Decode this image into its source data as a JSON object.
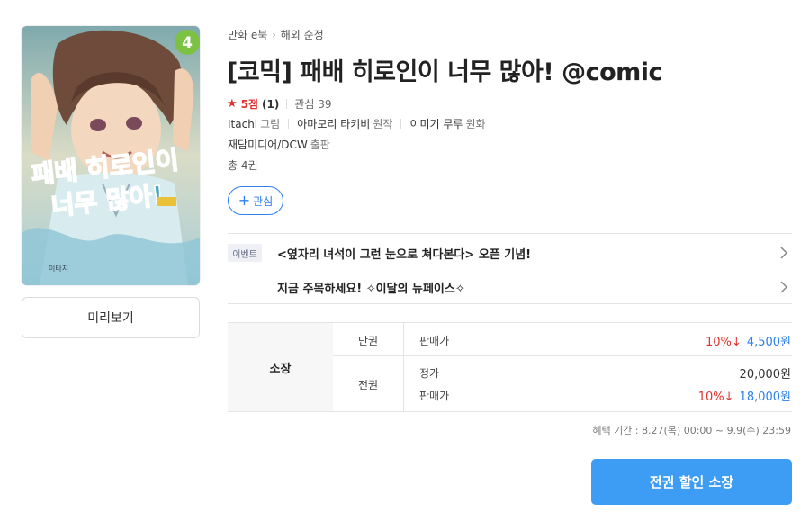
{
  "cover": {
    "volume_number": "4",
    "title_line1": "패배 히로인이",
    "title_line2": "너무 많아!",
    "author": "이타치"
  },
  "preview_label": "미리보기",
  "breadcrumb": [
    "만화 e북",
    "해외 순정"
  ],
  "title": "[코믹] 패배 히로인이 너무 많아! @comic",
  "rating": {
    "score": "5점",
    "count": "(1)",
    "wish": "관심 39"
  },
  "credits": [
    {
      "name": "Itachi",
      "role": "그림"
    },
    {
      "name": "아마모리 타키비",
      "role": "원작"
    },
    {
      "name": "이미기 무루",
      "role": "원화"
    }
  ],
  "publisher": {
    "name": "재담미디어/DCW",
    "role": "출판"
  },
  "volumes": "총 4권",
  "wish_button": "관심",
  "events": [
    {
      "badge": "이벤트",
      "text": "<옆자리 녀석이 그런 눈으로 쳐다본다> 오픈 기념!"
    },
    {
      "badge": "",
      "text": "지금 주목하세요! ✧이달의 뉴페이스✧"
    }
  ],
  "price_table": {
    "ownership": "소장",
    "single": {
      "type": "단권",
      "label": "판매가",
      "discount": "10%↓",
      "price": "4,500원"
    },
    "full": {
      "type": "전권",
      "list_label": "정가",
      "list_price": "20,000원",
      "sale_label": "판매가",
      "discount": "10%↓",
      "price": "18,000원"
    }
  },
  "benefit_period": "혜택 기간 : 8.27(목) 00:00 ~ 9.9(수) 23:59",
  "buy_button": "전권 할인 소장",
  "colors": {
    "accent_blue": "#2f80ed",
    "button_blue": "#3d9cf4",
    "discount_red": "#e0312e"
  }
}
